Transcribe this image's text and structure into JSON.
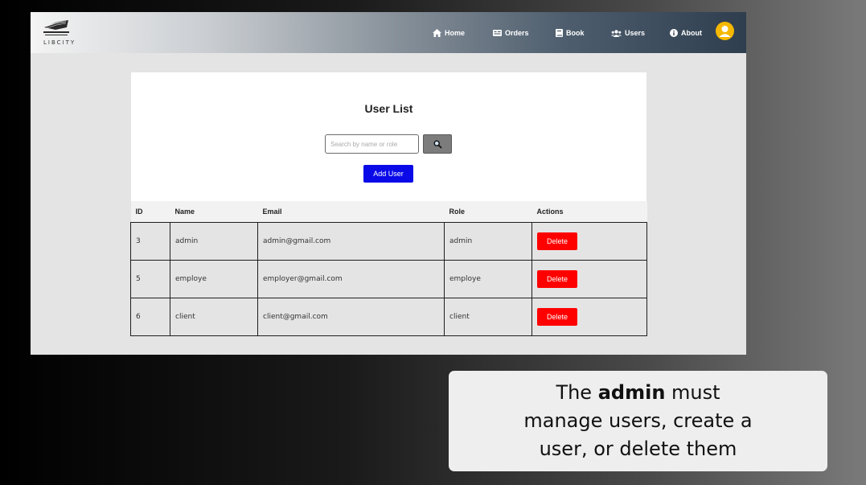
{
  "nav": {
    "logo_text": "LIBCITY",
    "items": [
      {
        "label": "Home",
        "icon": "home-icon"
      },
      {
        "label": "Orders",
        "icon": "orders-icon"
      },
      {
        "label": "Book",
        "icon": "book-icon"
      },
      {
        "label": "Users",
        "icon": "users-icon"
      },
      {
        "label": "About",
        "icon": "info-icon"
      }
    ],
    "avatar_icon": "user-icon",
    "avatar_color": "#f5b800"
  },
  "user_list": {
    "title": "User List",
    "search_placeholder": "Search by name or role",
    "search_value": "",
    "search_icon": "magnifier-icon",
    "add_user_label": "Add User",
    "add_user_color": "#0a0ae8",
    "columns": [
      "ID",
      "Name",
      "Email",
      "Role",
      "Actions"
    ],
    "rows": [
      {
        "id": "3",
        "name": "admin",
        "email": "admin@gmail.com",
        "role": "admin",
        "action": "Delete"
      },
      {
        "id": "5",
        "name": "employe",
        "email": "employer@gmail.com",
        "role": "employe",
        "action": "Delete"
      },
      {
        "id": "6",
        "name": "client",
        "email": "client@gmail.com",
        "role": "client",
        "action": "Delete"
      }
    ],
    "delete_color": "#ff0000"
  },
  "caption": {
    "before": "The ",
    "bold": "admin",
    "after": " must manage users, create a user, or delete them"
  }
}
